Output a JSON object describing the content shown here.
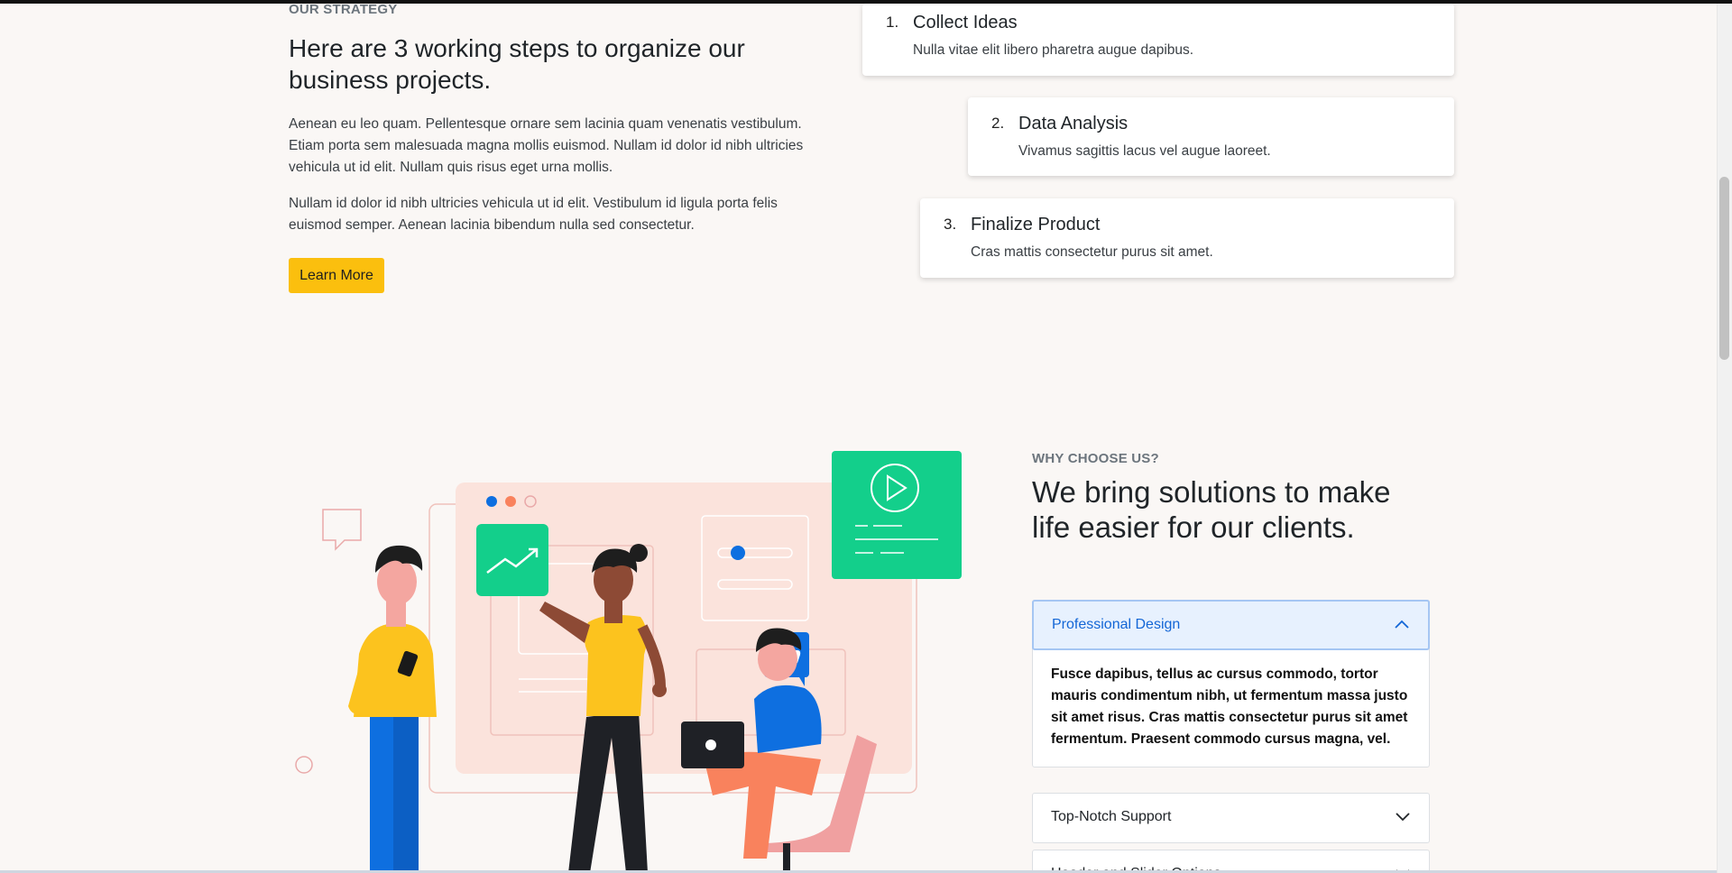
{
  "strategy": {
    "eyebrow": "OUR STRATEGY",
    "title": "Here are 3 working steps to organize our business projects.",
    "paragraph1": "Aenean eu leo quam. Pellentesque ornare sem lacinia quam venenatis vestibulum. Etiam porta sem malesuada magna mollis euismod. Nullam id dolor id nibh ultricies vehicula ut id elit. Nullam quis risus eget urna mollis.",
    "paragraph2": "Nullam id dolor id nibh ultricies vehicula ut id elit. Vestibulum id ligula porta felis euismod semper. Aenean lacinia bibendum nulla sed consectetur.",
    "button_label": "Learn More",
    "button_color": "#fbbf0e",
    "steps": [
      {
        "number": "1.",
        "title": "Collect Ideas",
        "text": "Nulla vitae elit libero pharetra augue dapibus."
      },
      {
        "number": "2.",
        "title": "Data Analysis",
        "text": "Vivamus sagittis lacus vel augue laoreet."
      },
      {
        "number": "3.",
        "title": "Finalize Product",
        "text": "Cras mattis consectetur purus sit amet."
      }
    ]
  },
  "why": {
    "eyebrow": "WHY CHOOSE US?",
    "title": "We bring solutions to make life easier for our clients.",
    "accordion": [
      {
        "label": "Professional Design",
        "expanded": true,
        "body": "Fusce dapibus, tellus ac cursus commodo, tortor mauris condimentum nibh, ut fermentum massa justo sit amet risus. Cras mattis consectetur purus sit amet fermentum. Praesent commodo cursus magna, vel."
      },
      {
        "label": "Top-Notch Support",
        "expanded": false
      },
      {
        "label": "Header and Slider Options",
        "expanded": false
      }
    ],
    "accent_color": "#1366d6"
  },
  "illustration": {
    "icons": [
      "chart-up-icon",
      "play-icon",
      "thumbs-up-icon",
      "laptop-icon",
      "phone-icon",
      "chat-bubble-icon"
    ],
    "colors": {
      "green": "#13cf8b",
      "blue": "#0e6fe0",
      "yellow": "#fcc31e",
      "peach": "#fbe3dc",
      "orange": "#f9825d"
    }
  }
}
